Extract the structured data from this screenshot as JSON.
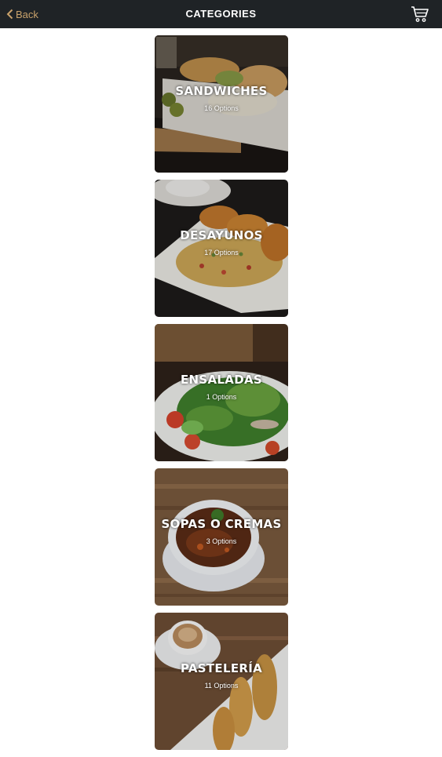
{
  "header": {
    "back_label": "Back",
    "title": "CATEGORIES",
    "back_icon": "chevron-left-icon",
    "cart_icon": "cart-icon",
    "accent_color": "#c9a26b",
    "bar_color": "#1f2326"
  },
  "categories": [
    {
      "name": "SANDWICHES",
      "options": "16 Options"
    },
    {
      "name": "DESAYUNOS",
      "options": "17 Options"
    },
    {
      "name": "ENSALADAS",
      "options": "1 Options"
    },
    {
      "name": "SOPAS O CREMAS",
      "options": "3 Options"
    },
    {
      "name": "PASTELERÍA",
      "options": "11 Options"
    }
  ]
}
